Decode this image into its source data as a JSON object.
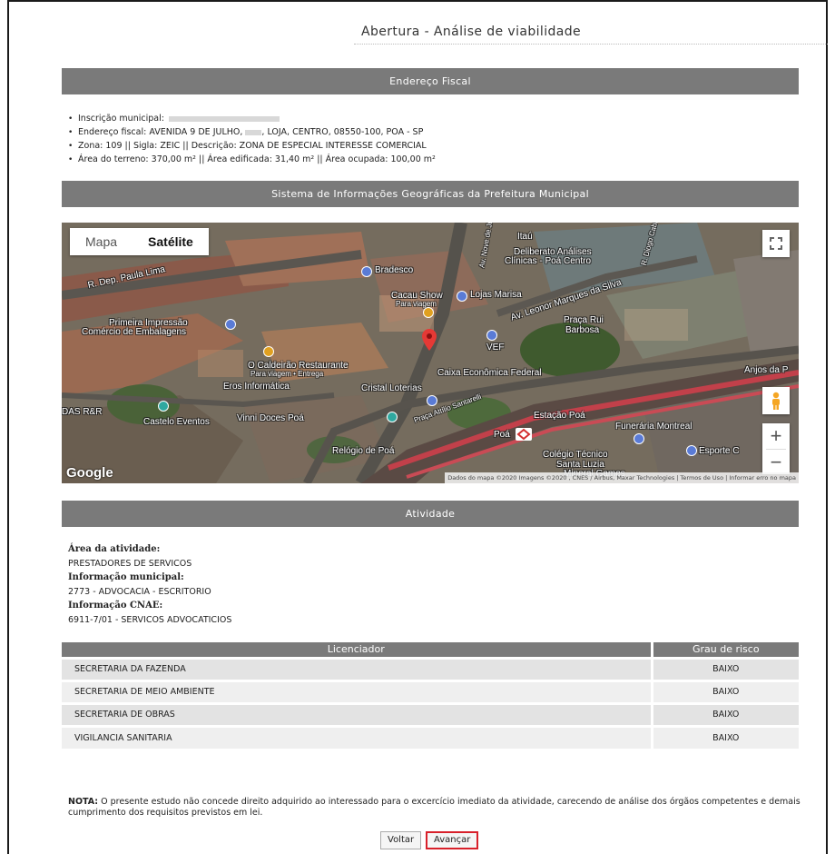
{
  "page": {
    "title": "Abertura - Análise de viabilidade"
  },
  "fiscal": {
    "header": "Endereço Fiscal",
    "inscricao_label": "Inscrição municipal:",
    "endereco_prefix": "Endereço fiscal: AVENIDA 9 DE JULHO,",
    "endereco_suffix": ", LOJA, CENTRO, 08550-100, POA - SP",
    "zona": "Zona: 109 || Sigla: ZEIC || Descrição: ZONA DE ESPECIAL INTERESSE COMERCIAL",
    "area": "Área do terreno: 370,00 m² || Área edificada: 31,40 m² || Área ocupada: 100,00 m²"
  },
  "sig": {
    "header": "Sistema de Informações Geográficas da Prefeitura Municipal",
    "map": {
      "tab_map": "Mapa",
      "tab_satellite": "Satélite",
      "selected": "Satélite",
      "logo": "Google",
      "attribution": "Dados do mapa ©2020 Imagens ©2020 , CNES / Airbus, Maxar Technologies | Termos de Uso | Informar erro no mapa",
      "labels": {
        "dep_paula_lima": "R. Dep. Paula Lima",
        "primeira": "Primeira Impressão",
        "comercio": "Comércio de Embalagens",
        "bradesco": "Bradesco",
        "cacau": "Cacau Show",
        "para_viagem": "Para viagem",
        "lojas_marisa": "Lojas Marisa",
        "itau": "Itaú",
        "deliberato": "Deliberato Análises",
        "clinicas": "Clínicas - Poá Centro",
        "leonor": "Av. Leonor Marques da Silva",
        "praca_rui": "Praça Rui",
        "barbosa": "Barbosa",
        "vef": "VEF",
        "caldeirao": "O Caldeirão Restaurante",
        "caldeirao_sub": "Para viagem • Entrega",
        "caixa": "Caixa Econômica Federal",
        "anjos": "Anjos da P",
        "eros": "Eros Informática",
        "cristal": "Cristal Loterias",
        "das_rr": "DAS R&R",
        "castelo": "Castelo Eventos",
        "vinni": "Vinni Doces Poá",
        "estacao": "Estação Poá",
        "poa": "Poá",
        "funeraria": "Funerária Montreal",
        "relogio": "Relógio de Poá",
        "colegio": "Colégio Técnico",
        "santa_luzia": "Santa Luzia",
        "esporte": "Esporte C",
        "mineral": "Mineral Games",
        "praca_attilio": "Praça Attílio Santarelli",
        "av_nove": "Av. Nove de Jul",
        "diogo": "R. Diogo Cabral"
      }
    }
  },
  "atividade": {
    "header": "Atividade",
    "area_label": "Área da atividade:",
    "area_value": "PRESTADORES DE SERVICOS",
    "municipal_label": "Informação municipal:",
    "municipal_value": "2773 - ADVOCACIA - ESCRITORIO",
    "cnae_label": "Informação CNAE:",
    "cnae_value": "6911-7/01 - SERVICOS ADVOCATICIOS"
  },
  "table": {
    "col_licenciador": "Licenciador",
    "col_grau": "Grau de risco",
    "rows": [
      {
        "licenciador": "SECRETARIA DA FAZENDA",
        "grau": "BAIXO"
      },
      {
        "licenciador": "SECRETARIA DE MEIO AMBIENTE",
        "grau": "BAIXO"
      },
      {
        "licenciador": "SECRETARIA DE OBRAS",
        "grau": "BAIXO"
      },
      {
        "licenciador": "VIGILANCIA SANITARIA",
        "grau": "BAIXO"
      }
    ]
  },
  "nota": {
    "label": "NOTA:",
    "text": " O presente estudo não concede direito adquirido ao interessado para o excercício imediato da atividade, carecendo de análise dos órgãos competentes e demais cumprimento dos requisitos previstos em lei."
  },
  "buttons": {
    "voltar": "Voltar",
    "avancar": "Avançar"
  },
  "colors": {
    "section_bar": "#7a7a7a",
    "highlight_border": "#d8202a",
    "map_pin": "#e53935"
  }
}
